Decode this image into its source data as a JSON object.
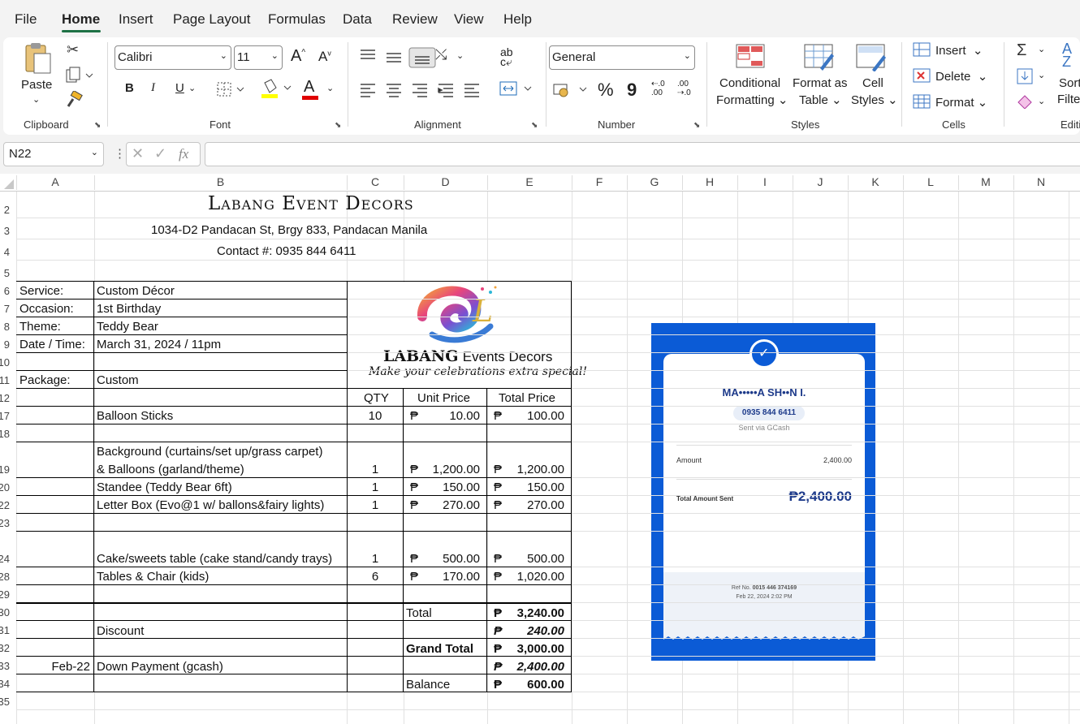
{
  "menu": {
    "tabs": [
      "File",
      "Home",
      "Insert",
      "Page Layout",
      "Formulas",
      "Data",
      "Review",
      "View",
      "Help"
    ],
    "active": "Home"
  },
  "ribbon": {
    "clipboard": {
      "paste": "Paste",
      "label": "Clipboard"
    },
    "font": {
      "name": "Calibri",
      "size": "11",
      "label": "Font",
      "bold": "B",
      "italic": "I",
      "underline": "U",
      "grow": "A",
      "shrink": "A",
      "fontcolor": "A"
    },
    "alignment": {
      "label": "Alignment"
    },
    "number": {
      "format": "General",
      "percent": "%",
      "comma": "9",
      "label": "Number"
    },
    "styles": {
      "cond1": "Conditional",
      "cond2": "Formatting",
      "fmt1": "Format as",
      "fmt2": "Table",
      "cell1": "Cell",
      "cell2": "Styles",
      "label": "Styles"
    },
    "cells": {
      "insert": "Insert",
      "delete": "Delete",
      "format": "Format",
      "label": "Cells"
    },
    "editing": {
      "sort1": "Sort",
      "sort2": "Filter",
      "label": "Editi"
    }
  },
  "formula_bar": {
    "name_box": "N22",
    "fx": "fx",
    "value": ""
  },
  "columns": [
    "A",
    "B",
    "C",
    "D",
    "E",
    "F",
    "G",
    "H",
    "I",
    "J",
    "K",
    "L",
    "M",
    "N"
  ],
  "rows": [
    "2",
    "3",
    "4",
    "5",
    "6",
    "7",
    "8",
    "9",
    "10",
    "11",
    "12",
    "17",
    "18",
    "19",
    "20",
    "22",
    "23",
    "24",
    "28",
    "29",
    "30",
    "31",
    "32",
    "33",
    "34",
    "35"
  ],
  "sheet": {
    "title": "Labang Event Decors",
    "address": "1034-D2 Pandacan St, Brgy 833, Pandacan Manila",
    "contact": "Contact #: 0935 844 6411",
    "info": [
      {
        "label": "Service:",
        "value": "Custom Décor"
      },
      {
        "label": "Occasion:",
        "value": "1st Birthday"
      },
      {
        "label": "Theme:",
        "value": "Teddy Bear"
      },
      {
        "label": "Date / Time:",
        "value": "March 31, 2024 / 11pm"
      },
      {
        "label": "",
        "value": ""
      },
      {
        "label": "Package:",
        "value": "Custom"
      }
    ],
    "logo": {
      "brand": "LABANG",
      "brand2": "Events Decors",
      "tagline": "Make your celebrations extra special!",
      "mark": "L"
    },
    "headers": {
      "qty": "QTY",
      "unit": "Unit Price",
      "total": "Total Price"
    },
    "currency": "₱",
    "items": [
      {
        "desc": "Balloon Sticks",
        "desc2": "",
        "qty": "10",
        "unit": "10.00",
        "total": "100.00"
      },
      {
        "desc": "Background (curtains/set up/grass carpet)",
        "desc2": "& Balloons (garland/theme)",
        "qty": "1",
        "unit": "1,200.00",
        "total": "1,200.00"
      },
      {
        "desc": "Standee (Teddy Bear 6ft)",
        "desc2": "",
        "qty": "1",
        "unit": "150.00",
        "total": "150.00"
      },
      {
        "desc": "Letter Box (Evo@1 w/ ballons&fairy lights)",
        "desc2": "",
        "qty": "1",
        "unit": "270.00",
        "total": "270.00"
      },
      {
        "desc": "Cake/sweets table (cake stand/candy trays)",
        "desc2": "",
        "qty": "1",
        "unit": "500.00",
        "total": "500.00"
      },
      {
        "desc": "Tables & Chair (kids)",
        "desc2": "",
        "qty": "6",
        "unit": "170.00",
        "total": "1,020.00"
      }
    ],
    "summary": {
      "total_label": "Total",
      "total": "3,240.00",
      "discount_label": "Discount",
      "discount": "240.00",
      "grand_label": "Grand Total",
      "grand": "3,000.00",
      "dp_date": "Feb-22",
      "dp_label": "Down Payment (gcash)",
      "dp": "2,400.00",
      "balance_label": "Balance",
      "balance": "600.00"
    }
  },
  "receipt": {
    "name": "MA•••••A SH••N I.",
    "number": "0935 844 6411",
    "via": "Sent via GCash",
    "amount_label": "Amount",
    "amount": "2,400.00",
    "total_label": "Total Amount Sent",
    "total": "₱2,400.00",
    "ref_label": "Ref No.",
    "ref": "0015 446 374169",
    "date": "Feb 22, 2024 2:02 PM"
  },
  "colors": {
    "excel_green": "#1e7145",
    "gcash_blue": "#0b5bd6"
  }
}
